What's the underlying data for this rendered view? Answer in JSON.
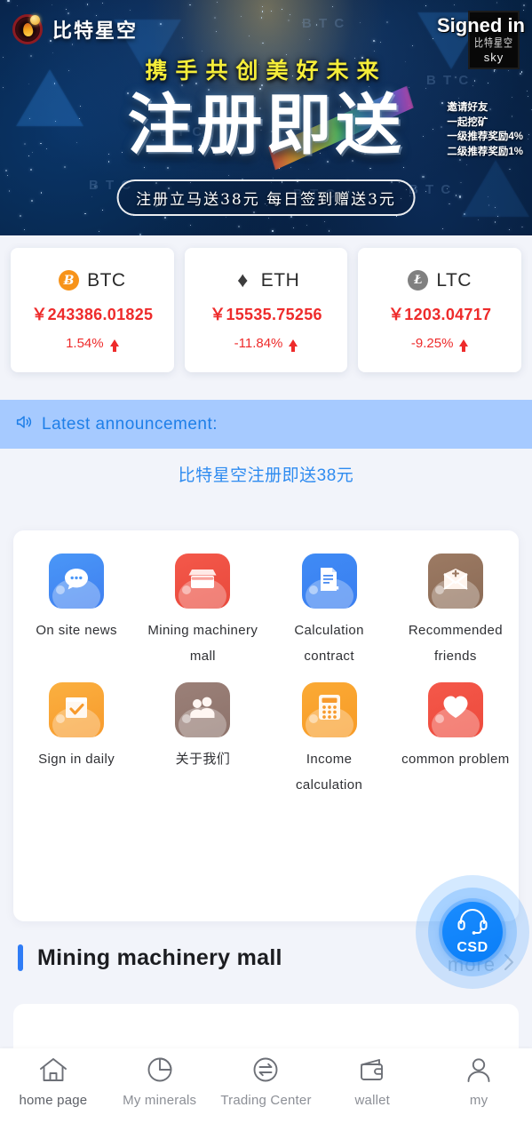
{
  "header": {
    "brand": "比特星空",
    "signed_in": "Signed in",
    "stamp_cn": "比特星空",
    "stamp_en": "sky",
    "logo_icon": "bitcoin-flame-logo-icon"
  },
  "hero": {
    "subtitle": "携手共创美好未来",
    "headline": "注册即送",
    "ribbon": "注册立马送38元  每日签到赠送3元",
    "side_lines": [
      "邀请好友",
      "一起挖矿",
      "一级推荐奖励4%",
      "二级推荐奖励1%"
    ],
    "ghost_watermark": "B T C"
  },
  "prices": [
    {
      "symbol": "BTC",
      "icon": "bitcoin-coin-icon",
      "glyph": "Ƀ",
      "price": "￥243386.01825",
      "change": "1.54%",
      "direction": "up"
    },
    {
      "symbol": "ETH",
      "icon": "ethereum-coin-icon",
      "glyph": "♦",
      "price": "￥15535.75256",
      "change": "-11.84%",
      "direction": "up"
    },
    {
      "symbol": "LTC",
      "icon": "litecoin-coin-icon",
      "glyph": "Ł",
      "price": "￥1203.04717",
      "change": "-9.25%",
      "direction": "up"
    }
  ],
  "announcement": {
    "label": "Latest announcement:",
    "icon": "speaker-icon",
    "text": "比特星空注册即送38元"
  },
  "menu": [
    {
      "label": "On site news",
      "icon": "chat-bubble-icon",
      "color": "#4a97f7"
    },
    {
      "label": "Mining machinery mall",
      "icon": "storefront-icon",
      "color": "#f4584a"
    },
    {
      "label": "Calculation contract",
      "icon": "contract-stamp-icon",
      "color": "#3f8bf5"
    },
    {
      "label": "Recommended friends",
      "icon": "envelope-plus-icon",
      "color": "#9c7a63"
    },
    {
      "label": "Sign in daily",
      "icon": "calendar-check-icon",
      "color": "#fbb040"
    },
    {
      "label": "关于我们",
      "icon": "two-people-icon",
      "color": "#9b8078"
    },
    {
      "label": "Income calculation",
      "icon": "calculator-icon",
      "color": "#fbaa35"
    },
    {
      "label": "common problem",
      "icon": "heart-icon",
      "color": "#f4584a"
    }
  ],
  "section": {
    "title": "Mining machinery mall",
    "more": "more",
    "more_icon": "chevron-right-icon",
    "accent": "#2f7cf6"
  },
  "csd": {
    "label": "CSD",
    "icon": "headset-icon",
    "color": "#0a7ef7"
  },
  "tabbar": [
    {
      "label": "home page",
      "icon": "home-icon",
      "active": true
    },
    {
      "label": "My minerals",
      "icon": "pie-chart-icon",
      "active": false
    },
    {
      "label": "Trading Center",
      "icon": "exchange-icon",
      "active": false
    },
    {
      "label": "wallet",
      "icon": "wallet-icon",
      "active": false
    },
    {
      "label": "my",
      "icon": "person-icon",
      "active": false
    }
  ],
  "colors": {
    "page_bg": "#f2f4fa",
    "announce_bg": "#a6caff",
    "announce_text": "#1f7fe8",
    "price_red": "#ee2b2b",
    "brand_blue": "#2f7cf6"
  }
}
